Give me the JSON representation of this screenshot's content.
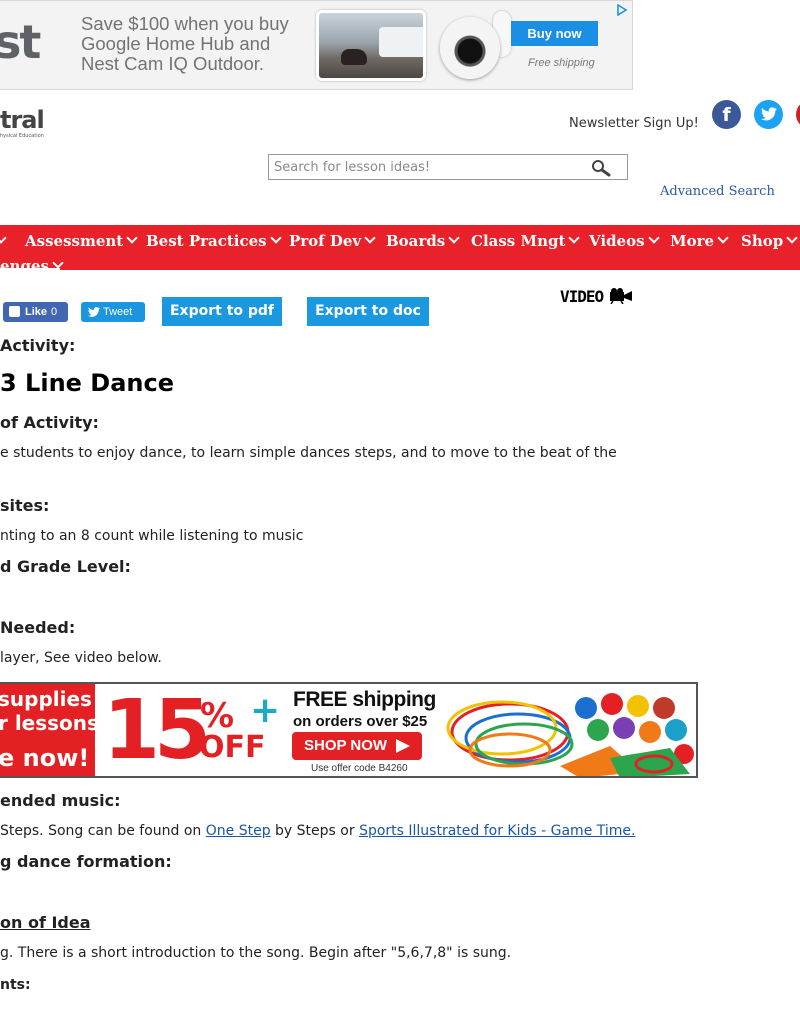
{
  "top_ad": {
    "brand": "st",
    "text": "Save $100 when you buy Google Home Hub and Nest Cam IQ Outdoor.",
    "button": "Buy now",
    "shipping": "Free shipping"
  },
  "header": {
    "logo_word": "tral",
    "logo_sub": "hysical Education",
    "newsletter": "Newsletter Sign Up!",
    "social": [
      "facebook-icon",
      "twitter-icon",
      "pinterest-icon"
    ]
  },
  "search": {
    "placeholder": "Search for lesson ideas!",
    "advanced": "Advanced Search"
  },
  "nav": {
    "items": [
      "Assessment",
      "Best Practices",
      "Prof Dev",
      "Boards",
      "Class Mngt",
      "Videos",
      "More",
      "Shop"
    ],
    "row2": "enges"
  },
  "share": {
    "like": "Like",
    "like_count": "0",
    "tweet": "Tweet",
    "export_pdf": "Export to pdf",
    "export_doc": "Export to doc",
    "video": "VIDEO"
  },
  "content": {
    "name_label": "Activity:",
    "title": "3 Line Dance",
    "purpose_label": "of Activity:",
    "purpose_text": "e students to enjoy dance, to learn simple dances steps, and to move to the beat of the",
    "prereq_label": "sites:",
    "prereq_text": "nting to an 8 count while listening to music",
    "grade_label": "d Grade Level:",
    "materials_label": " Needed:",
    "materials_text": "layer, See video below.",
    "music_label": "ended music:",
    "music_pre": " Steps. Song can be found on ",
    "music_link1": "One Step",
    "music_mid": " by Steps or ",
    "music_link2": "Sports Illustrated for Kids - Game Time.",
    "formation_label": "g dance formation:",
    "description_label": "on of Idea",
    "description_text": "g. There is a short introduction to the song. Begin after \"5,6,7,8\" is sung.",
    "movements_label": "nts:"
  },
  "mid_ad": {
    "line1": "supplies",
    "line2": "r lessons?",
    "line3": "e now!",
    "percent": "15",
    "percent_sign": "%",
    "off": "OFF",
    "plus": "+",
    "free_shipping": "FREE shipping",
    "orders_over": "on orders over $25",
    "shop_now": "SHOP NOW",
    "offer_code": "Use offer code B4260"
  }
}
